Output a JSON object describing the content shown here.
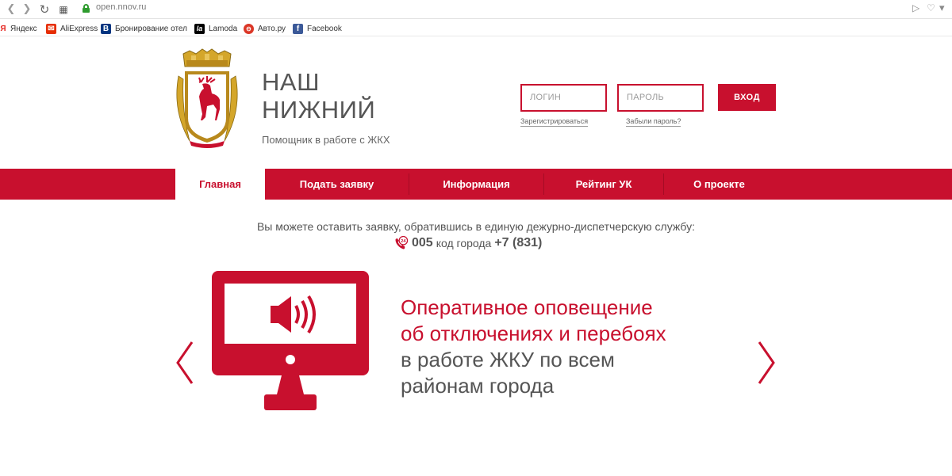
{
  "browser": {
    "back_icon": "back-arrow",
    "forward_icon": "forward-arrow",
    "reload_icon": "reload",
    "apps_icon": "apps-grid",
    "url": "open.nnov.ru",
    "secure": true,
    "right_icons": [
      "send-icon",
      "heart-icon"
    ]
  },
  "bookmarks": [
    {
      "label": "Яндекс",
      "icon": "yandex",
      "color": "#e52620"
    },
    {
      "label": "AliExpress",
      "icon": "aliexpress",
      "color": "#e62e04"
    },
    {
      "label": "Бронирование отел",
      "icon": "booking",
      "color": "#003580"
    },
    {
      "label": "Lamoda",
      "icon": "lamoda",
      "color": "#000000"
    },
    {
      "label": "Авто.ру",
      "icon": "autoru",
      "color": "#db3727"
    },
    {
      "label": "Facebook",
      "icon": "facebook",
      "color": "#3b5998"
    }
  ],
  "header": {
    "title_line1": "НАШ",
    "title_line2": "НИЖНИЙ",
    "subtitle": "Помощник в работе с ЖКХ",
    "login_placeholder": "ЛОГИН",
    "password_placeholder": "ПАРОЛЬ",
    "login_button": "ВХОД",
    "register_link": "Зарегистрироваться",
    "forgot_link": "Забыли пароль?"
  },
  "nav": {
    "items": [
      {
        "label": "Главная",
        "active": true
      },
      {
        "label": "Подать заявку",
        "active": false
      },
      {
        "label": "Информация",
        "active": false
      },
      {
        "label": "Рейтинг УК",
        "active": false
      },
      {
        "label": "О проекте",
        "active": false
      }
    ]
  },
  "info": {
    "text": "Вы можете оставить заявку, обратившись в единую дежурно-диспетчерскую службу:",
    "phone_short": "005",
    "phone_mid": "код города",
    "phone_city": "+7 (831)",
    "badge": "24"
  },
  "slider": {
    "line1": "Оперативное оповещение",
    "line2": "об отключениях и перебоях",
    "line3": "в работе ЖКУ по всем",
    "line4": "районам города"
  },
  "colors": {
    "accent": "#c8102e",
    "text": "#555555"
  }
}
